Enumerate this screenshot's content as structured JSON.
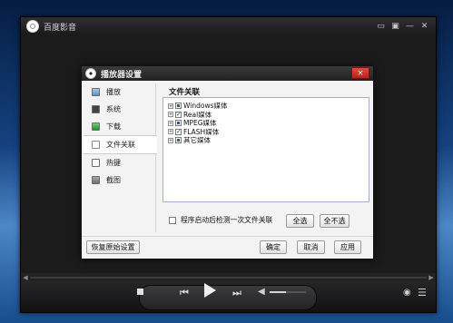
{
  "app": {
    "title": "百度影音",
    "window_controls": [
      "▭",
      "▣",
      "—",
      "✕"
    ]
  },
  "dialog": {
    "title": "播放器设置",
    "close": "×",
    "sidebar": [
      {
        "label": "播放",
        "active": false
      },
      {
        "label": "系统",
        "active": false
      },
      {
        "label": "下载",
        "active": false
      },
      {
        "label": "文件关联",
        "active": true
      },
      {
        "label": "热键",
        "active": false
      },
      {
        "label": "截图",
        "active": false
      }
    ],
    "panel_title": "文件关联",
    "tree": [
      {
        "label": "Windows媒体",
        "expand": "+",
        "state": "partial"
      },
      {
        "label": "Real媒体",
        "expand": "+",
        "state": "checked"
      },
      {
        "label": "MPEG媒体",
        "expand": "+",
        "state": "partial"
      },
      {
        "label": "FLASH媒体",
        "expand": "+",
        "state": "checked"
      },
      {
        "label": "其它媒体",
        "expand": "+",
        "state": "partial"
      }
    ],
    "startup_check_label": "程序启动后检测一次文件关联",
    "startup_checked": false,
    "buttons": {
      "select_all": "全选",
      "select_none": "全不选",
      "restore": "恢复原始设置",
      "ok": "确定",
      "cancel": "取消",
      "apply": "应用"
    }
  },
  "player": {
    "volume": 0.45
  },
  "colors": {
    "close_red": "#d23a2e",
    "tree_border": "#9fb4cc"
  }
}
